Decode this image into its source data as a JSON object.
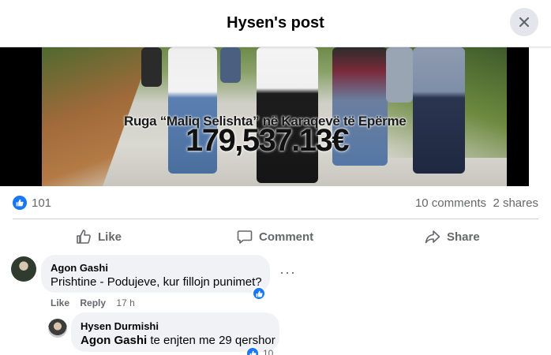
{
  "header": {
    "title": "Hysen's post"
  },
  "media": {
    "caption_line": "Ruga “Maliq Selishta” në Karaqevë të Epërme",
    "caption_amount": "179,537.13€"
  },
  "stats": {
    "likes": "101",
    "comments": "10 comments",
    "shares": "2 shares"
  },
  "actions": {
    "like": "Like",
    "comment": "Comment",
    "share": "Share"
  },
  "comments": [
    {
      "author": "Agon Gashi",
      "text": "Prishtine - Podujeve, kur fillojn punimet?",
      "like_label": "Like",
      "reply_label": "Reply",
      "time": "17 h",
      "more": "···"
    }
  ],
  "reply": {
    "author": "Hysen Durmishi",
    "mention": "Agon Gashi",
    "text": "te enjten me 29 qershor",
    "reaction_count": "10"
  },
  "colors": {
    "accent": "#1877f2",
    "secondary_text": "#65676b",
    "bubble": "#f0f2f5"
  }
}
